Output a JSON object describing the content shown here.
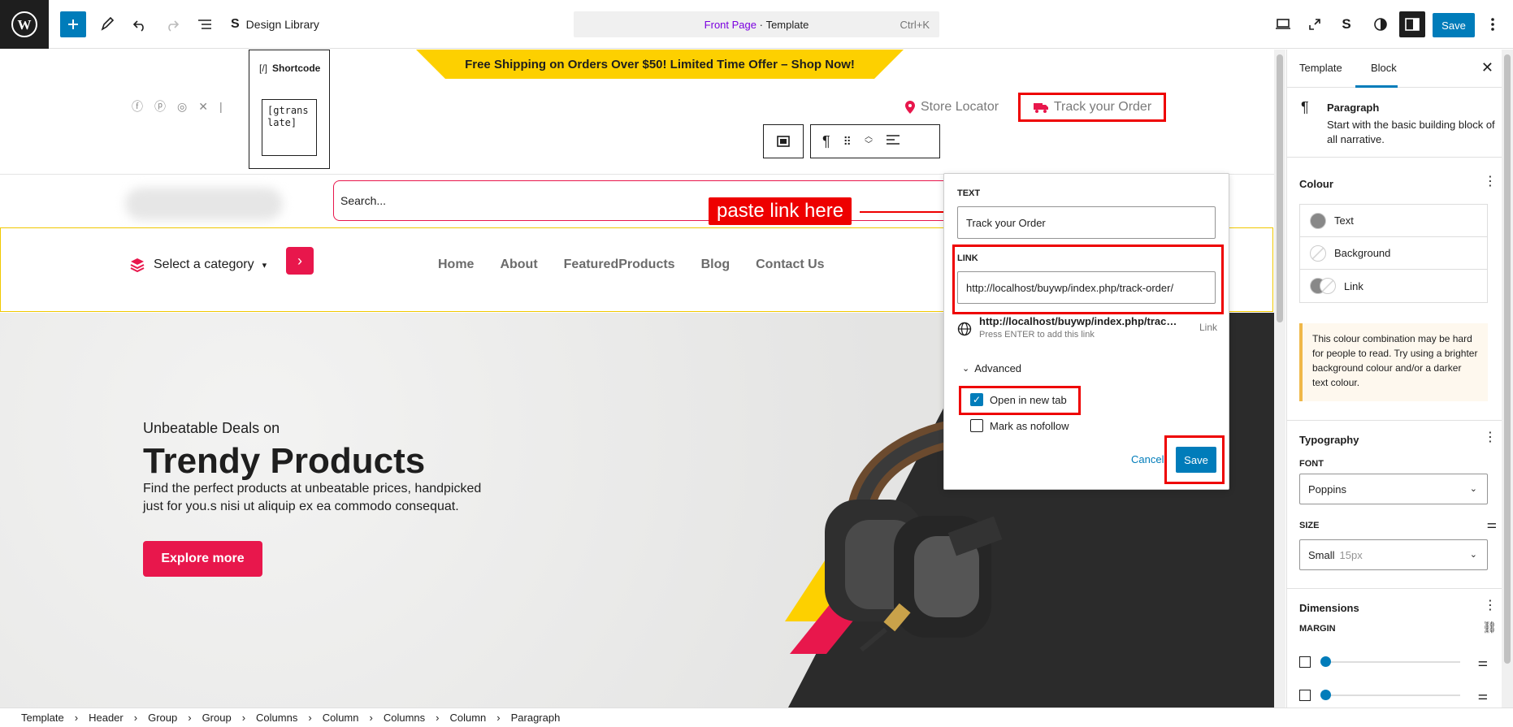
{
  "topbar": {
    "design_library": "Design Library",
    "command": {
      "page": "Front Page",
      "sep": " · ",
      "type": "Template",
      "shortcut": "Ctrl+K"
    },
    "save_label": "Save"
  },
  "canvas": {
    "promo": "Free Shipping on Orders Over $50! Limited Time Offer – Shop Now!",
    "shortcode": {
      "label": "Shortcode",
      "bracket": "[/]",
      "value": "[gtranslate]"
    },
    "store_locator": "Store Locator",
    "track_order": "Track your Order",
    "search_placeholder": "Search...",
    "annotation": "paste link here",
    "category": "Select a category",
    "menu": [
      "Home",
      "About",
      "FeaturedProducts",
      "Blog",
      "Contact Us"
    ],
    "hero": {
      "subtitle": "Unbeatable Deals on",
      "title": "Trendy Products",
      "description": "Find the perfect products at unbeatable prices, handpicked just for you.s nisi ut aliquip ex ea commodo consequat.",
      "button": "Explore more"
    }
  },
  "popover": {
    "text_label": "TEXT",
    "text_value": "Track your Order",
    "link_label": "LINK",
    "link_value": "http://localhost/buywp/index.php/track-order/",
    "suggestion_url": "http://localhost/buywp/index.php/track-order/",
    "suggestion_hint": "Press ENTER to add this link",
    "suggestion_type": "Link",
    "advanced": "Advanced",
    "open_new_tab": "Open in new tab",
    "nofollow": "Mark as nofollow",
    "cancel": "Cancel",
    "save": "Save"
  },
  "sidebar": {
    "tabs": [
      "Template",
      "Block"
    ],
    "active_tab": "Block",
    "block": {
      "name": "Paragraph",
      "description": "Start with the basic building block of all narrative."
    },
    "colour": {
      "title": "Colour",
      "items": [
        "Text",
        "Background",
        "Link"
      ]
    },
    "warning": "This colour combination may be hard for people to read. Try using a brighter background colour and/or a darker text colour.",
    "typography": {
      "title": "Typography",
      "font_label": "FONT",
      "font_value": "Poppins",
      "size_label": "SIZE",
      "size_value": "Small",
      "size_hint": "15px"
    },
    "dimensions": {
      "title": "Dimensions",
      "margin_label": "MARGIN"
    }
  },
  "breadcrumb": [
    "Template",
    "Header",
    "Group",
    "Group",
    "Columns",
    "Column",
    "Columns",
    "Column",
    "Paragraph"
  ],
  "colors": {
    "accent": "#007cba",
    "brand_red": "#e8174c",
    "brand_yellow": "#fdd000",
    "annotation_red": "#ee0000"
  }
}
